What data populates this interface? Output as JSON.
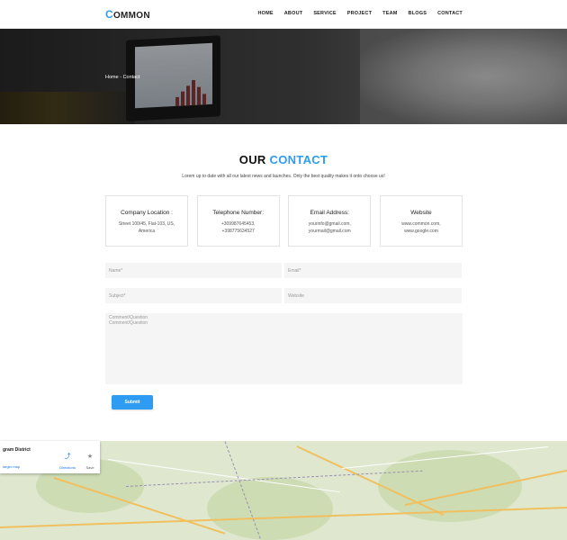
{
  "header": {
    "logo_initial": "C",
    "logo_rest": "OMMON",
    "nav": [
      "HOME",
      "ABOUT",
      "SERVICE",
      "PROJECT",
      "TEAM",
      "BLOGS",
      "CONTACT"
    ]
  },
  "hero": {
    "breadcrumb_home": "Home",
    "breadcrumb_sep": " - ",
    "breadcrumb_current": "Contact"
  },
  "section": {
    "title_plain": "OUR ",
    "title_accent": "CONTACT",
    "subtitle": "Lorem up to date with all our latest news and launches. Only the best quality makes it onto choose us!"
  },
  "cards": [
    {
      "title": "Company Location :",
      "lines": [
        "Street 100/45, Flat-103, US,",
        "America"
      ]
    },
    {
      "title": "Telephone Number:",
      "lines": [
        "+309987645453,",
        "+398775634527"
      ]
    },
    {
      "title": "Email Address:",
      "lines": [
        "yourinfo@gmail.com,",
        "yourmail@gmail.com"
      ]
    },
    {
      "title": "Website",
      "lines": [
        "www.common.com,",
        "www.google.com"
      ]
    }
  ],
  "form": {
    "name_placeholder": "Name*",
    "email_placeholder": "Email*",
    "subject_placeholder": "Subject*",
    "website_placeholder": "Website",
    "comment_placeholder": "Comment/Question",
    "comment_value": "Comment/Question",
    "submit_label": "Submit"
  },
  "map": {
    "place_title": "gram District",
    "larger_map_link": "larger map",
    "directions_label": "Directions",
    "save_label": "Save",
    "colors": {
      "land": "#dfe8cf",
      "road": "#f0c060",
      "link": "#1a73e8"
    }
  },
  "colors": {
    "accent": "#2d9cf2"
  }
}
